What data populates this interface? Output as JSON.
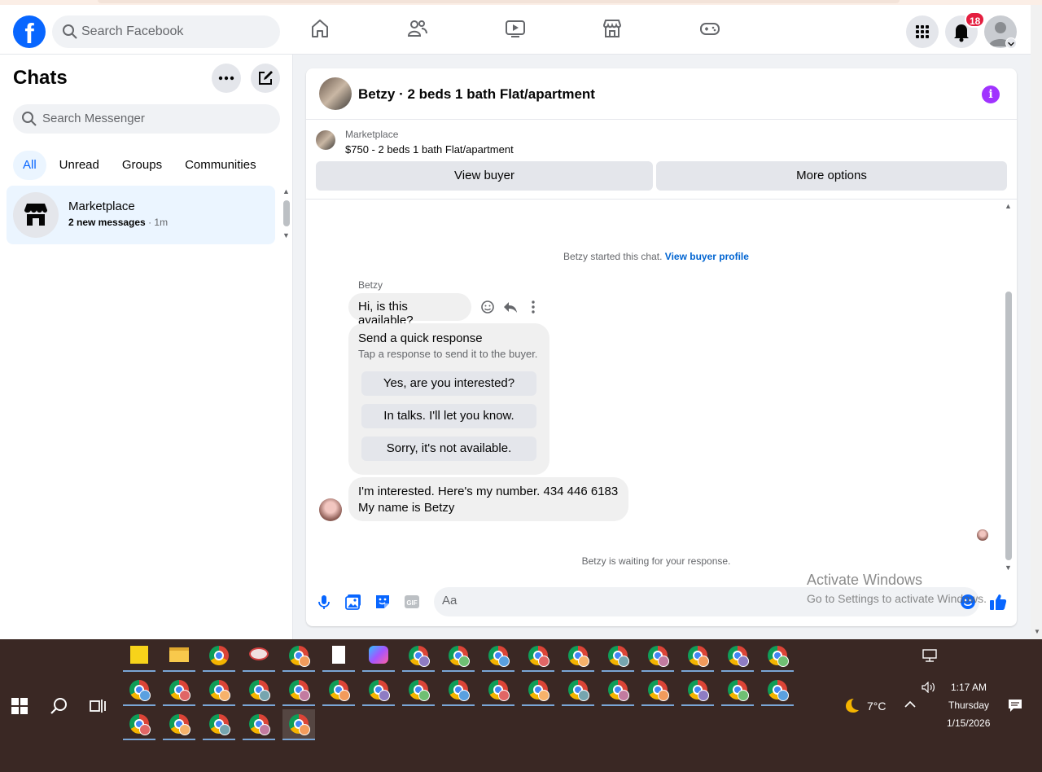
{
  "header": {
    "search_placeholder": "Search Facebook",
    "notification_count": "18"
  },
  "sidebar": {
    "title": "Chats",
    "search_placeholder": "Search Messenger",
    "tabs": [
      "All",
      "Unread",
      "Groups",
      "Communities"
    ],
    "chat": {
      "name": "Marketplace",
      "unread_text": "2 new messages",
      "time": " · 1m"
    }
  },
  "conversation": {
    "title": "Betzy · 2 beds 1 bath Flat/apartment",
    "marketplace_label": "Marketplace",
    "listing": "$750 - 2 beds 1 bath Flat/apartment",
    "view_buyer": "View buyer",
    "more_options": "More options",
    "started_text": "Betzy started this chat. ",
    "view_profile_link": "View buyer profile",
    "sender_name": "Betzy",
    "message1": "Hi, is this available?",
    "quick_title": "Send a quick response",
    "quick_subtitle": "Tap a response to send it to the buyer.",
    "quick_options": [
      "Yes, are you interested?",
      "In talks. I'll let you know.",
      "Sorry, it's not available."
    ],
    "message2_line1": "I'm interested. Here's my number. 434 446 6183",
    "message2_line2": "My name is  Betzy",
    "waiting_text": "Betzy is waiting for your response.",
    "composer_placeholder": "Aa"
  },
  "watermark": {
    "line1": "Activate Windows",
    "line2": "Go to Settings to activate Windows."
  },
  "taskbar": {
    "temperature": "7°C",
    "time": "1:17 AM",
    "day": "Thursday",
    "date": "1/15/2026"
  },
  "colors": {
    "brand": "#0866ff",
    "info": "#a033ff",
    "badge": "#e41e3f"
  }
}
